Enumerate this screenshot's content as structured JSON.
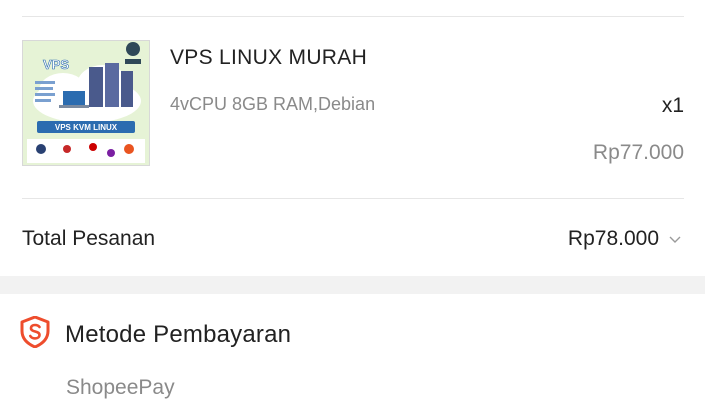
{
  "order_item": {
    "thumbnail": {
      "alt_icon": "vps-product-thumbnail",
      "logo_text": "VPS",
      "banner_text": "VPS KVM LINUX"
    },
    "product_name": "VPS LINUX MURAH",
    "variation": "4vCPU 8GB RAM,Debian",
    "quantity": "x1",
    "price": "Rp77.000"
  },
  "order_total": {
    "label": "Total Pesanan",
    "amount": "Rp78.000",
    "expand_icon": "chevron-down-icon"
  },
  "payment": {
    "icon": "shield-s-icon",
    "title": "Metode Pembayaran",
    "method": "ShopeePay"
  },
  "colors": {
    "accent": "#ee4d2d",
    "text_primary": "#222222",
    "text_secondary": "#8a8a8a",
    "thumb_bg": "#e6f3d6",
    "thumb_banner": "#2b6cb0"
  }
}
